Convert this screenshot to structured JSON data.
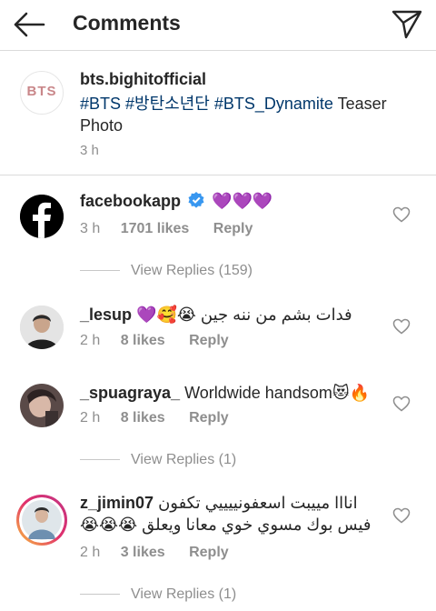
{
  "header": {
    "title": "Comments"
  },
  "caption": {
    "avatar_text": "BTS",
    "username": "bts.bighitofficial",
    "tags": [
      "#BTS",
      "#방탄소년단",
      "#BTS_Dynamite"
    ],
    "text_suffix": "Teaser Photo",
    "time": "3 h"
  },
  "comments": [
    {
      "username": "facebookapp",
      "verified": true,
      "text": "💜💜💜",
      "time": "3 h",
      "likes": "1701 likes",
      "reply": "Reply",
      "view_replies": "View Replies (159)"
    },
    {
      "username": "_lesup",
      "text": "فدات بشم من ننه جين 😭🥰💜",
      "time": "2 h",
      "likes": "8 likes",
      "reply": "Reply"
    },
    {
      "username": "_spuagraya_",
      "text": "Worldwide handsom😻🔥",
      "time": "2 h",
      "likes": "8 likes",
      "reply": "Reply",
      "view_replies": "View Replies (1)"
    },
    {
      "username": "z_jimin07",
      "text_line1": "انااا مييبت اسعفونييييي تكفون",
      "text_line2": "فيس بوك مسوي خوي معانا ويعلق 😭😭😭",
      "time": "2 h",
      "likes": "3 likes",
      "reply": "Reply",
      "view_replies": "View Replies (1)"
    }
  ],
  "colors": {
    "text": "#262626",
    "secondary": "#8e8e8e",
    "hashtag": "#00376b",
    "verified": "#3897f0",
    "facebook": "#000000",
    "story_ring": "#d6249f"
  },
  "icons": {
    "back": "arrow-left-icon",
    "send": "paper-plane-icon",
    "like": "heart-outline-icon",
    "verified": "verified-badge-icon"
  }
}
